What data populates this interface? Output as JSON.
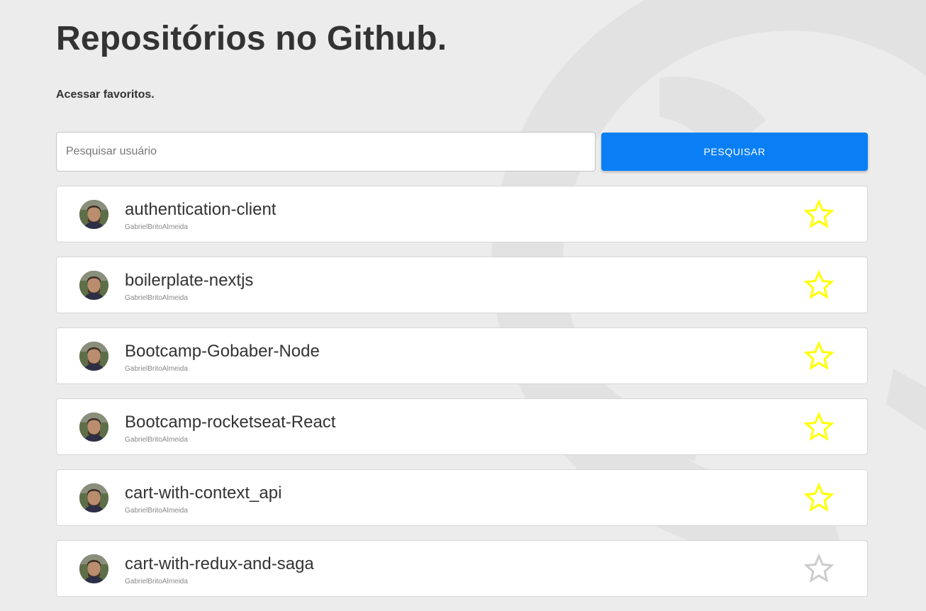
{
  "header": {
    "title": "Repositórios no Github.",
    "favorites_link": "Acessar favoritos."
  },
  "search": {
    "placeholder": "Pesquisar usuário",
    "value": "",
    "button_label": "PESQUISAR"
  },
  "colors": {
    "accent": "#0a7ff5",
    "star_favorited": "#ffff00",
    "star_default": "#cccccc"
  },
  "repositories": [
    {
      "name": "authentication-client",
      "owner": "GabrielBritoAlmeida",
      "favorited": true
    },
    {
      "name": "boilerplate-nextjs",
      "owner": "GabrielBritoAlmeida",
      "favorited": true
    },
    {
      "name": "Bootcamp-Gobaber-Node",
      "owner": "GabrielBritoAlmeida",
      "favorited": true
    },
    {
      "name": "Bootcamp-rocketseat-React",
      "owner": "GabrielBritoAlmeida",
      "favorited": true
    },
    {
      "name": "cart-with-context_api",
      "owner": "GabrielBritoAlmeida",
      "favorited": true
    },
    {
      "name": "cart-with-redux-and-saga",
      "owner": "GabrielBritoAlmeida",
      "favorited": false
    }
  ],
  "icons": {
    "background": "github-logo-icon",
    "avatar": "avatar",
    "favorite": "star-icon"
  }
}
